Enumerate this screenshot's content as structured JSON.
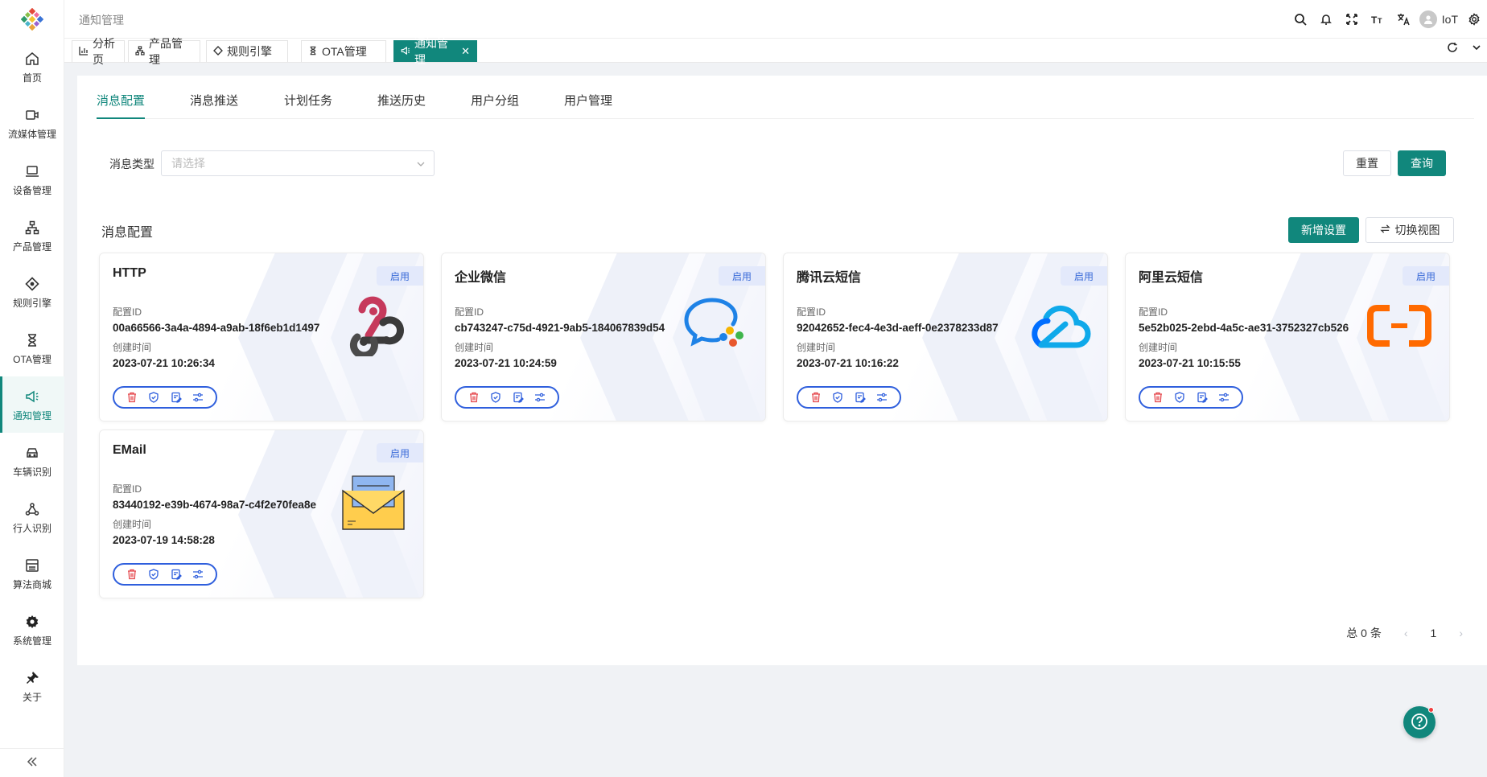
{
  "sidebar": {
    "items": [
      {
        "label": "首页",
        "icon": "home-icon"
      },
      {
        "label": "流媒体管理",
        "icon": "video-camera-icon"
      },
      {
        "label": "设备管理",
        "icon": "laptop-icon"
      },
      {
        "label": "产品管理",
        "icon": "hierarchy-icon"
      },
      {
        "label": "规则引擎",
        "icon": "diamond-icon"
      },
      {
        "label": "OTA管理",
        "icon": "hourglass-icon"
      },
      {
        "label": "通知管理",
        "icon": "megaphone-icon",
        "active": true
      },
      {
        "label": "车辆识别",
        "icon": "car-icon"
      },
      {
        "label": "行人识别",
        "icon": "nodes-icon"
      },
      {
        "label": "算法商城",
        "icon": "store-icon"
      },
      {
        "label": "系统管理",
        "icon": "gear-icon"
      },
      {
        "label": "关于",
        "icon": "pin-icon"
      }
    ]
  },
  "header": {
    "breadcrumb": "通知管理",
    "user_name": "IoT"
  },
  "tabs": [
    {
      "label": "分析页",
      "icon": "bar-chart-icon"
    },
    {
      "label": "产品管理",
      "icon": "hierarchy-icon"
    },
    {
      "label": "规则引擎",
      "icon": "diamond-icon"
    },
    {
      "label": "OTA管理",
      "icon": "hourglass-icon"
    },
    {
      "label": "通知管理",
      "icon": "megaphone-icon",
      "active": true
    }
  ],
  "subtabs": [
    "消息配置",
    "消息推送",
    "计划任务",
    "推送历史",
    "用户分组",
    "用户管理"
  ],
  "filter": {
    "label": "消息类型",
    "placeholder": "请选择",
    "reset": "重置",
    "query": "查询"
  },
  "section": {
    "title": "消息配置",
    "add_button": "新增设置",
    "switch_view": "切换视图"
  },
  "cards": [
    {
      "title": "HTTP",
      "status": "启用",
      "id_label": "配置ID",
      "id": "00a66566-3a4a-4894-a9ab-18f6eb1d1497",
      "time_label": "创建时间",
      "time": "2023-07-21 10:26:34",
      "icon": "webhook-icon"
    },
    {
      "title": "企业微信",
      "status": "启用",
      "id_label": "配置ID",
      "id": "cb743247-c75d-4921-9ab5-184067839d54",
      "time_label": "创建时间",
      "time": "2023-07-21 10:24:59",
      "icon": "wecom-icon"
    },
    {
      "title": "腾讯云短信",
      "status": "启用",
      "id_label": "配置ID",
      "id": "92042652-fec4-4e3d-aeff-0e2378233d87",
      "time_label": "创建时间",
      "time": "2023-07-21 10:16:22",
      "icon": "tencent-cloud-icon"
    },
    {
      "title": "阿里云短信",
      "status": "启用",
      "id_label": "配置ID",
      "id": "5e52b025-2ebd-4a5c-ae31-3752327cb526",
      "time_label": "创建时间",
      "time": "2023-07-21 10:15:55",
      "icon": "aliyun-icon"
    },
    {
      "title": "EMail",
      "status": "启用",
      "id_label": "配置ID",
      "id": "83440192-e39b-4674-98a7-c4f2e70fea8e",
      "time_label": "创建时间",
      "time": "2023-07-19 14:58:28",
      "icon": "envelope-icon"
    }
  ],
  "pagination": {
    "total": "总 0 条",
    "page": "1"
  },
  "colors": {
    "primary": "#11877c",
    "badge_bg": "#e3e9fb",
    "badge_text": "#3a6bd8",
    "action_border": "#2f5fdd",
    "danger": "#e5484d"
  }
}
